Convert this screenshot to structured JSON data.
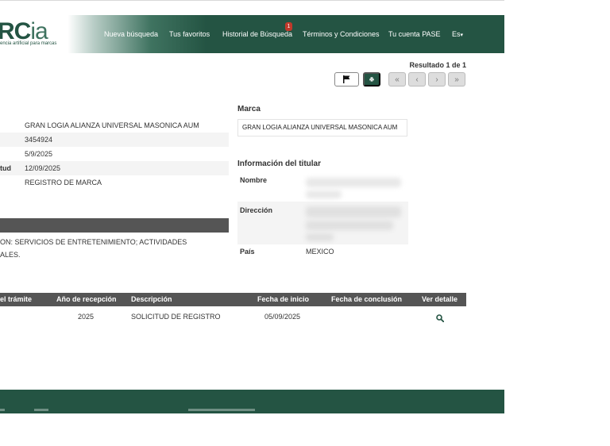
{
  "header": {
    "logo_main": "RC",
    "logo_suffix": "ia",
    "logo_sub": "encia artificial para marcas",
    "nav": [
      {
        "label": "Nueva búsqueda"
      },
      {
        "label": "Tus favoritos"
      },
      {
        "label": "Historial de Búsqueda",
        "badge": "1"
      },
      {
        "label": "Términos y Condiciones"
      },
      {
        "label": "Tu cuenta PASE"
      },
      {
        "label": "Es"
      }
    ]
  },
  "result": {
    "label": "Resultado 1 de 1",
    "buttons": {
      "flag": "flag-icon",
      "print": "print-icon",
      "first": "«",
      "prev": "‹",
      "next": "›",
      "last": "»"
    }
  },
  "details": {
    "rows": [
      {
        "label": "",
        "value": "GRAN LOGIA ALIANZA UNIVERSAL MASONICA AUM"
      },
      {
        "label": "",
        "value": "3454924"
      },
      {
        "label": "",
        "value": "5/9/2025"
      },
      {
        "label": "tud",
        "value": "12/09/2025"
      },
      {
        "label": "",
        "value": "REGISTRO DE MARCA"
      }
    ],
    "services_line1": "ON: SERVICIOS DE ENTRETENIMIENTO; ACTIVIDADES",
    "services_line2": "ALES."
  },
  "marca": {
    "title": "Marca",
    "value": "GRAN LOGIA ALIANZA UNIVERSAL MASONICA AUM"
  },
  "titular": {
    "title": "Información del titular",
    "nombre_label": "Nombre",
    "direccion_label": "Dirección",
    "pais_label": "País",
    "pais_value": "MEXICO"
  },
  "tramites": {
    "columns": [
      "el trámite",
      "Año de recepción",
      "Descripción",
      "Fecha de inicio",
      "Fecha de conclusión",
      "Ver detalle"
    ],
    "rows": [
      {
        "tramite": "",
        "anio": "2025",
        "descripcion": "SOLICITUD DE REGISTRO",
        "inicio": "05/09/2025",
        "conclusion": "",
        "detalle_icon": "search-icon"
      }
    ]
  },
  "colors": {
    "brand": "#245443",
    "header_dark": "#555555",
    "badge": "#c0392b"
  }
}
